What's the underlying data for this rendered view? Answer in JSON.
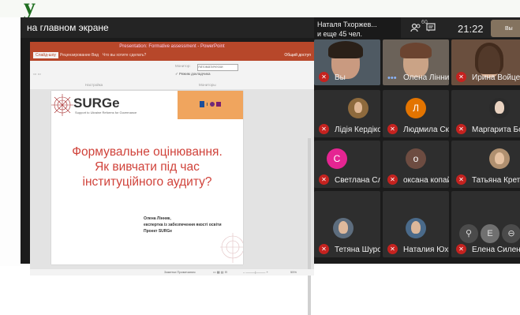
{
  "overlay_text": "у",
  "header": {
    "title": "на главном экране",
    "notification_line1": "Наталя Тхоржев...",
    "notification_line2": "и еще 45 чел.",
    "people_count": "60",
    "time": "21:22",
    "self_label": "Вы"
  },
  "ppt": {
    "window_title": "Presentation: Formative assessment - PowerPoint",
    "tabs": [
      "Слайд-шоу",
      "Рецензирование",
      "Вид",
      "Что вы хотите сделать?"
    ],
    "share": "Общий доступ",
    "ribbon": {
      "monitor_label": "Монитор:",
      "monitor_value": "Автоматически",
      "presenter_view": "Режим докладчика",
      "group_setup": "Настройка",
      "group_monitors": "Мониторы"
    },
    "slide": {
      "logo": "SURGe",
      "logo_sub": "Support to Ukraine Reforms for Governance",
      "title_line1": "Формувальне оцінювання.",
      "title_line2": "Як вивчати під час",
      "title_line3": "інституційного аудиту?",
      "author_line1": "Олена Лінник,",
      "author_line2": "експертка із забезпечення якості освіти",
      "author_line3": "Проект SURGe"
    },
    "status": "Заметки   Примечания",
    "zoom": "55%"
  },
  "participants": [
    {
      "name": "Вы",
      "kind": "video"
    },
    {
      "name": "Олена Лінник",
      "kind": "video"
    },
    {
      "name": "Ирина Войцехо...",
      "kind": "video"
    },
    {
      "name": "Лідія Кердікош...",
      "kind": "photo"
    },
    {
      "name": "Людмила Скри...",
      "kind": "letter",
      "letter": "Л",
      "color": "#e37400"
    },
    {
      "name": "Маргарита Бон...",
      "kind": "photo"
    },
    {
      "name": "Светлана Слоб...",
      "kind": "letter",
      "letter": "С",
      "color": "#e52592"
    },
    {
      "name": "оксана копайго...",
      "kind": "letter",
      "letter": "о",
      "color": "#6d4c41"
    },
    {
      "name": "Татьяна Кретов...",
      "kind": "photo"
    },
    {
      "name": "Тетяна Шурова",
      "kind": "photo"
    },
    {
      "name": "Наталия Юхиме...",
      "kind": "photo"
    },
    {
      "name": "Елена Силенко",
      "kind": "photo"
    }
  ],
  "controls": [
    "pin-icon",
    "present-icon",
    "remove-icon"
  ]
}
